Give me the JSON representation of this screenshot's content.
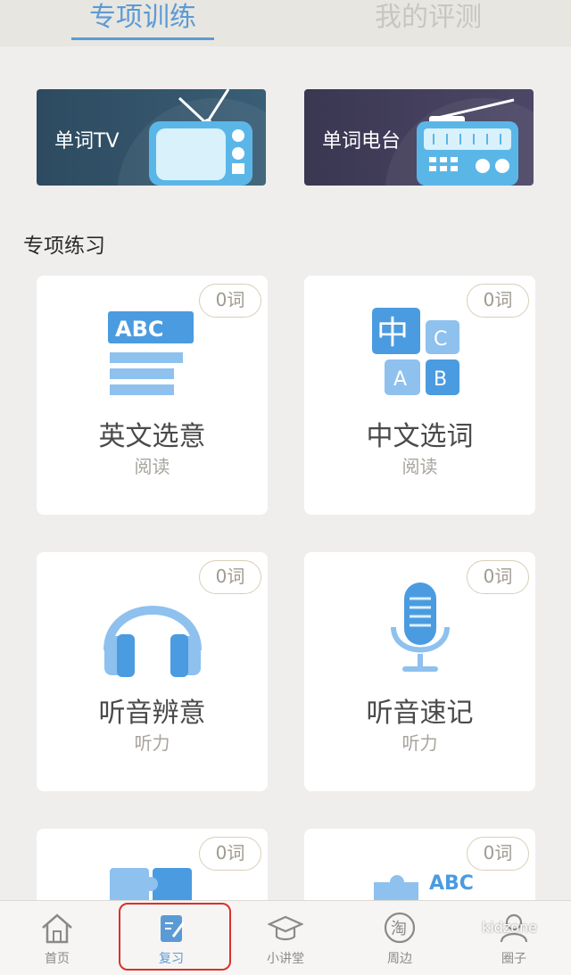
{
  "tabs": [
    {
      "label": "专项训练",
      "active": true
    },
    {
      "label": "我的评测",
      "active": false
    }
  ],
  "banners": [
    {
      "label": "单词TV",
      "icon": "tv-icon"
    },
    {
      "label": "单词电台",
      "icon": "radio-icon"
    }
  ],
  "section_title": "专项练习",
  "cards": [
    {
      "title": "英文选意",
      "subtitle": "阅读",
      "badge": "0词",
      "icon": "abc-text-icon"
    },
    {
      "title": "中文选词",
      "subtitle": "阅读",
      "badge": "0词",
      "icon": "chinese-abc-blocks-icon"
    },
    {
      "title": "听音辨意",
      "subtitle": "听力",
      "badge": "0词",
      "icon": "headphones-icon"
    },
    {
      "title": "听音速记",
      "subtitle": "听力",
      "badge": "0词",
      "icon": "microphone-icon"
    },
    {
      "title": "",
      "subtitle": "",
      "badge": "0词",
      "icon": "puzzle-icon"
    },
    {
      "title": "",
      "subtitle": "",
      "badge": "0词",
      "icon": "puzzle-abc-icon"
    }
  ],
  "puzzle_abc_text": "ABC",
  "abc_text": "ABC",
  "blocks": {
    "zh": "中",
    "c": "C",
    "a": "A",
    "b": "B"
  },
  "nav": [
    {
      "label": "首页",
      "icon": "home-icon",
      "active": false
    },
    {
      "label": "复习",
      "icon": "review-edit-icon",
      "active": true
    },
    {
      "label": "小讲堂",
      "icon": "graduation-cap-icon",
      "active": false
    },
    {
      "label": "周边",
      "icon": "tao-icon",
      "active": false,
      "glyph": "淘"
    },
    {
      "label": "圈子",
      "icon": "people-icon",
      "active": false
    }
  ],
  "watermark": "kidzone",
  "colors": {
    "accent": "#5b9bd5",
    "icon_light": "#8ec1ee",
    "badge_border": "#d9cfb9",
    "annotation": "#d8322c"
  }
}
